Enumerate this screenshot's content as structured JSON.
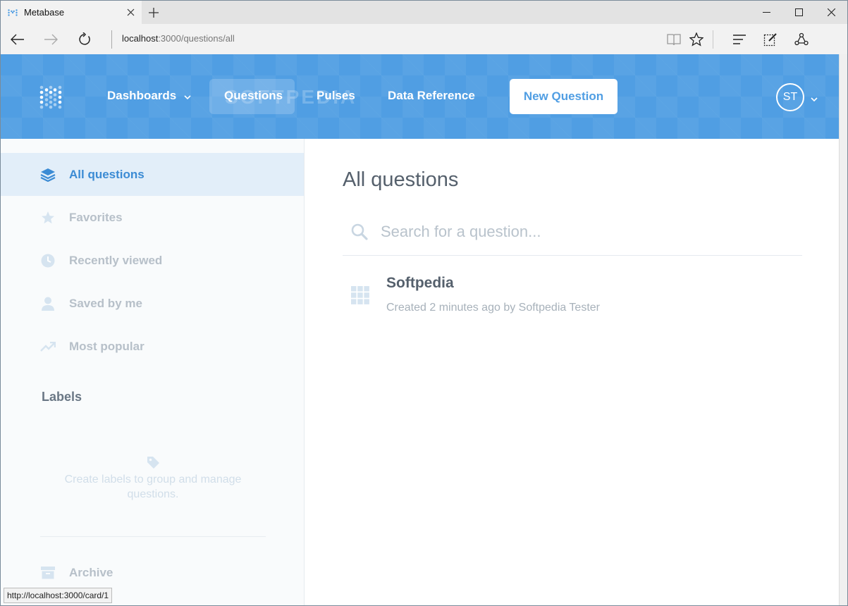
{
  "browser": {
    "tab_title": "Metabase",
    "address_host": "localhost",
    "address_rest": ":3000/questions/all",
    "status_url": "http://localhost:3000/card/1"
  },
  "header": {
    "nav": {
      "dashboards": "Dashboards",
      "questions": "Questions",
      "pulses": "Pulses",
      "data_reference": "Data Reference"
    },
    "new_question": "New Question",
    "avatar_initials": "ST",
    "watermark": "SOFTPEDIA",
    "brand_color": "#509ee3"
  },
  "sidebar": {
    "items": [
      {
        "label": "All questions",
        "icon": "stack-icon",
        "active": true
      },
      {
        "label": "Favorites",
        "icon": "star-icon",
        "active": false
      },
      {
        "label": "Recently viewed",
        "icon": "clock-icon",
        "active": false
      },
      {
        "label": "Saved by me",
        "icon": "person-icon",
        "active": false
      },
      {
        "label": "Most popular",
        "icon": "trending-icon",
        "active": false
      }
    ],
    "labels_heading": "Labels",
    "labels_empty": "Create labels to group and manage questions.",
    "archive": "Archive"
  },
  "main": {
    "title": "All questions",
    "search_placeholder": "Search for a question...",
    "questions": [
      {
        "title": "Softpedia",
        "meta": "Created 2 minutes ago by Softpedia Tester",
        "icon": "table-icon"
      }
    ]
  }
}
